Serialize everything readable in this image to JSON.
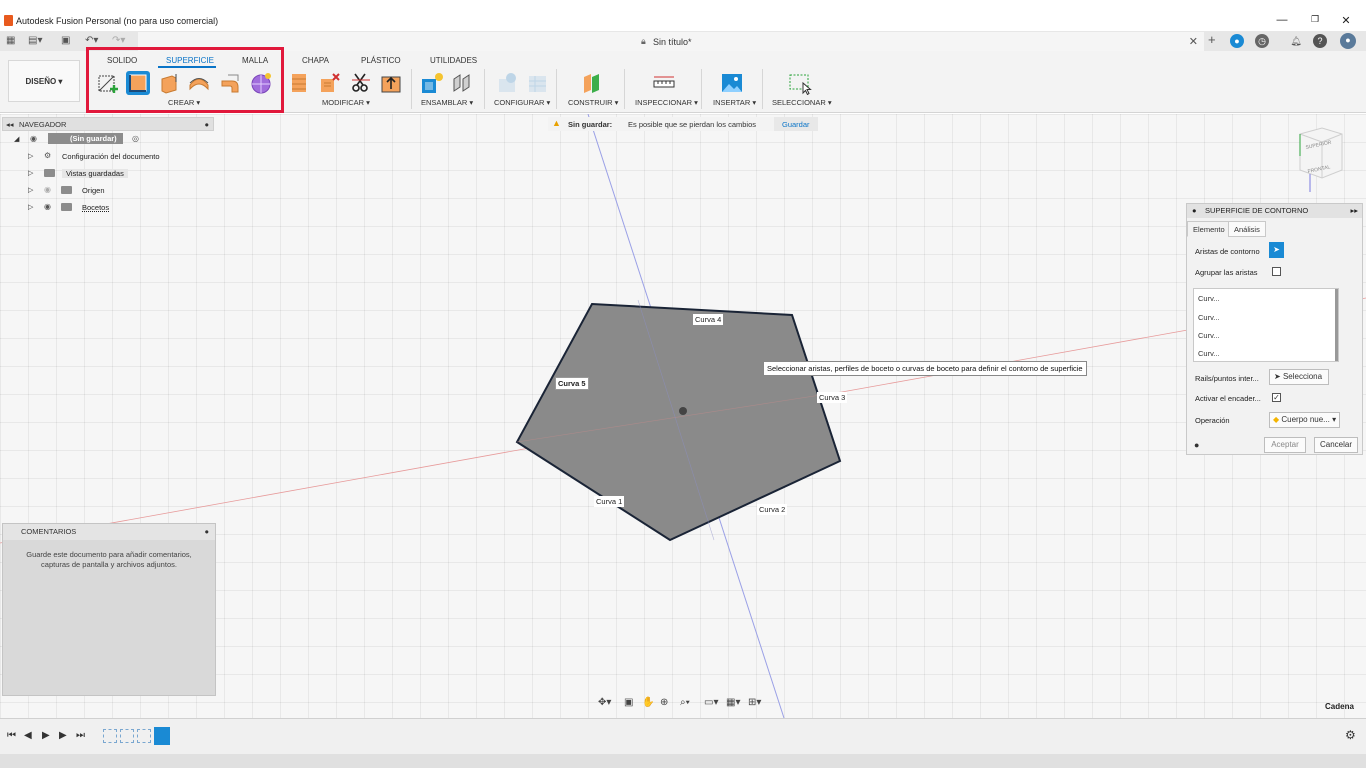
{
  "window": {
    "title": "Autodesk Fusion Personal (no para uso comercial)"
  },
  "document": {
    "name": "Sin título*"
  },
  "ribbon": {
    "workspace": "DISEÑO ▾",
    "tabs": [
      "SOLIDO",
      "SUPERFICIE",
      "MALLA",
      "CHAPA",
      "PLÁSTICO",
      "UTILIDADES"
    ],
    "active_tab": "SUPERFICIE",
    "groups": {
      "create": "CREAR ▾",
      "modify": "MODIFICAR ▾",
      "assemble": "ENSAMBLAR ▾",
      "configure": "CONFIGURAR ▾",
      "construct": "CONSTRUIR ▾",
      "inspect": "INSPECCIONAR ▾",
      "insert": "INSERTAR ▾",
      "select": "SELECCIONAR ▾"
    }
  },
  "navigator": {
    "title": "NAVEGADOR",
    "root": "(Sin guardar)",
    "items": [
      "Configuración del documento",
      "Vistas guardadas",
      "Origen",
      "Bocetos"
    ]
  },
  "unsaved": {
    "label": "Sin guardar:",
    "message": "Es posible que se pierdan los cambios",
    "save": "Guardar"
  },
  "viewcube": {
    "top": "SUPERIOR",
    "front": "FRONTAL"
  },
  "curves": {
    "c1": "Curva 1",
    "c2": "Curva 2",
    "c3": "Curva 3",
    "c4": "Curva 4",
    "c5": "Curva 5"
  },
  "tooltip": "Seleccionar aristas, perfiles de boceto o curvas de boceto para definir el contorno de superficie",
  "panel": {
    "title": "SUPERFICIE DE CONTORNO",
    "tab_element": "Elemento",
    "tab_analysis": "Análisis",
    "contour_edges": "Aristas de contorno",
    "group_edges": "Agrupar las aristas",
    "list": [
      "Curv...",
      "Curv...",
      "Curv...",
      "Curv..."
    ],
    "rails": "Rails/puntos inter...",
    "select": "Selecciona",
    "activate": "Activar el encader...",
    "operation": "Operación",
    "operation_value": "Cuerpo nue...",
    "accept": "Aceptar",
    "cancel": "Cancelar"
  },
  "comments": {
    "title": "COMENTARIOS",
    "body": "Guarde este documento para añadir comentarios, capturas de pantalla y archivos adjuntos."
  },
  "status": {
    "chain": "Cadena"
  },
  "colors": {
    "accent": "#0a74c7",
    "highlight": "#e1183b",
    "surface": "#8a8a8a"
  }
}
